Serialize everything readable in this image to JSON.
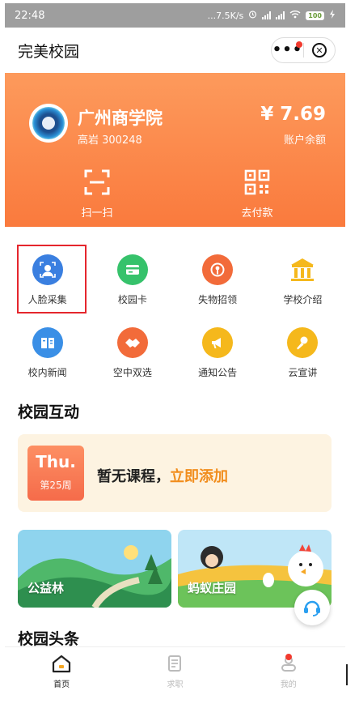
{
  "status_bar": {
    "time": "22:48",
    "network": "...7.5K/s",
    "battery": "100"
  },
  "title_bar": {
    "title": "完美校园"
  },
  "account": {
    "school_name": "广州商学院",
    "user_line": "高岩 300248",
    "balance": "¥ 7.69",
    "balance_label": "账户余额",
    "scan_label": "扫一扫",
    "pay_label": "去付款"
  },
  "grid": {
    "row1": [
      {
        "label": "人脸采集",
        "icon": "face-scan-icon",
        "color": "#3a7fe0"
      },
      {
        "label": "校园卡",
        "icon": "campus-card-icon",
        "color": "#36c26b"
      },
      {
        "label": "失物招领",
        "icon": "lost-found-icon",
        "color": "#f26b3a"
      },
      {
        "label": "学校介绍",
        "icon": "school-building-icon",
        "color": "#f5b81c"
      }
    ],
    "row2": [
      {
        "label": "校内新闻",
        "icon": "news-book-icon",
        "color": "#3a8fe6"
      },
      {
        "label": "空中双选",
        "icon": "handshake-icon",
        "color": "#f26b3a"
      },
      {
        "label": "通知公告",
        "icon": "megaphone-icon",
        "color": "#f5b81c"
      },
      {
        "label": "云宣讲",
        "icon": "microphone-icon",
        "color": "#f5b81c"
      }
    ]
  },
  "interaction": {
    "section_title": "校园互动",
    "day": "Thu.",
    "week": "第25周",
    "no_course": "暂无课程，",
    "add_link": "立即添加"
  },
  "banners": [
    {
      "label": "公益林"
    },
    {
      "label": "蚂蚁庄园"
    }
  ],
  "headlines": {
    "section_title": "校园头条"
  },
  "tabs": [
    {
      "label": "首页",
      "active": true
    },
    {
      "label": "求职",
      "active": false
    },
    {
      "label": "我的",
      "active": false
    }
  ],
  "colors": {
    "accent_orange": "#fa7a3d",
    "link_orange": "#f18d1d",
    "selection_red": "#e5262d"
  }
}
